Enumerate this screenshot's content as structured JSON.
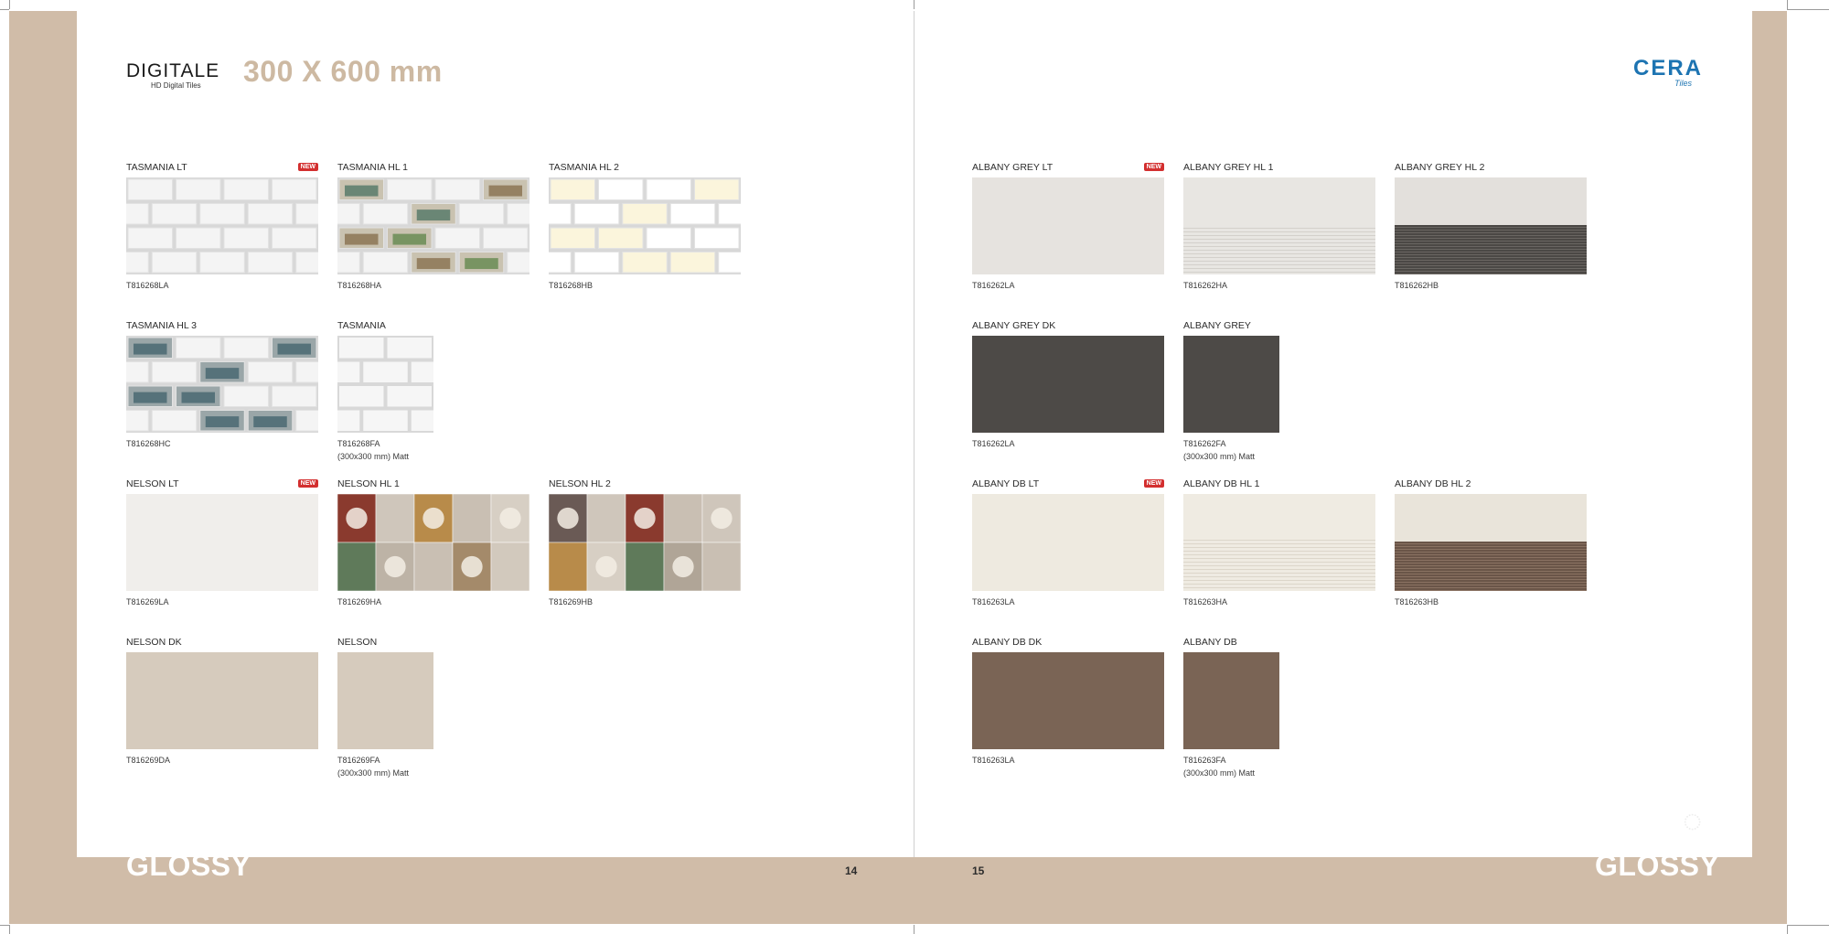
{
  "header": {
    "brand_name": "DIGITALE",
    "brand_sub": "HD Digital Tiles",
    "size_title": "300 X 600 mm",
    "cera_name": "CERA",
    "cera_sub": "Tiles"
  },
  "footer": {
    "left_label": "GLOSSY",
    "right_label": "GLOSSY",
    "left_page": "14",
    "right_page": "15"
  },
  "colors": {
    "beige_frame": "#d0bca8",
    "title_tan": "#cdb9a2",
    "cera_blue": "#1d74b2",
    "new_badge": "#d32f2f"
  },
  "badge_text": "NEW",
  "tiles": [
    {
      "name": "TASMANIA LT",
      "code": "T816268LA",
      "note": "",
      "new": true,
      "style": "subway-white"
    },
    {
      "name": "TASMANIA HL 1",
      "code": "T816268HA",
      "note": "",
      "new": false,
      "style": "subway-agate"
    },
    {
      "name": "TASMANIA HL 2",
      "code": "T816268HB",
      "note": "",
      "new": false,
      "style": "subway-gold"
    },
    {
      "name": "TASMANIA HL 3",
      "code": "T816268HC",
      "note": "",
      "new": false,
      "style": "subway-teal"
    },
    {
      "name": "TASMANIA",
      "code": "T816268FA",
      "note": "(300x300 mm) Matt",
      "new": false,
      "style": "subway-square"
    },
    {
      "name": "NELSON LT",
      "code": "T816269LA",
      "note": "",
      "new": true,
      "style": "plain-offwhite"
    },
    {
      "name": "NELSON HL 1",
      "code": "T816269HA",
      "note": "",
      "new": false,
      "style": "patchwork"
    },
    {
      "name": "NELSON HL 2",
      "code": "T816269HB",
      "note": "",
      "new": false,
      "style": "patchwork2"
    },
    {
      "name": "NELSON DK",
      "code": "T816269DA",
      "note": "",
      "new": false,
      "style": "plain-sand"
    },
    {
      "name": "NELSON",
      "code": "T816269FA",
      "note": "(300x300 mm) Matt",
      "new": false,
      "style": "plain-sand-sq"
    },
    {
      "name": "ALBANY GREY LT",
      "code": "T816262LA",
      "note": "",
      "new": true,
      "style": "plain-lightgrey"
    },
    {
      "name": "ALBANY GREY HL 1",
      "code": "T816262HA",
      "note": "",
      "new": false,
      "style": "lines-lightgrey"
    },
    {
      "name": "ALBANY GREY HL 2",
      "code": "T816262HB",
      "note": "",
      "new": false,
      "style": "band-dark"
    },
    {
      "name": "ALBANY GREY DK",
      "code": "T816262LA",
      "note": "",
      "new": false,
      "style": "plain-charcoal"
    },
    {
      "name": "ALBANY GREY",
      "code": "T816262FA",
      "note": "(300x300 mm) Matt",
      "new": false,
      "style": "plain-charcoal-sq"
    },
    {
      "name": "ALBANY DB LT",
      "code": "T816263LA",
      "note": "",
      "new": true,
      "style": "plain-cream"
    },
    {
      "name": "ALBANY DB HL 1",
      "code": "T816263HA",
      "note": "",
      "new": false,
      "style": "lines-cream"
    },
    {
      "name": "ALBANY DB HL 2",
      "code": "T816263HB",
      "note": "",
      "new": false,
      "style": "band-brown"
    },
    {
      "name": "ALBANY DB DK",
      "code": "T816263LA",
      "note": "",
      "new": false,
      "style": "plain-brown"
    },
    {
      "name": "ALBANY DB",
      "code": "T816263FA",
      "note": "(300x300 mm) Matt",
      "new": false,
      "style": "plain-brown-sq"
    }
  ]
}
